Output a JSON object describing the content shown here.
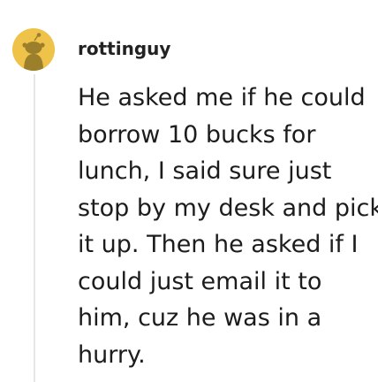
{
  "comment": {
    "author": {
      "username": "rottinguy",
      "avatar_icon": "snoo-avatar-icon",
      "avatar_color": "#efc34a"
    },
    "body_lines": [
      "He asked me if he could",
      "borrow 10 bucks for",
      "lunch, I said sure just",
      "stop by my desk and pick",
      "it up. Then he asked if I",
      "could just email it to",
      "him, cuz he was in a",
      "hurry."
    ]
  }
}
